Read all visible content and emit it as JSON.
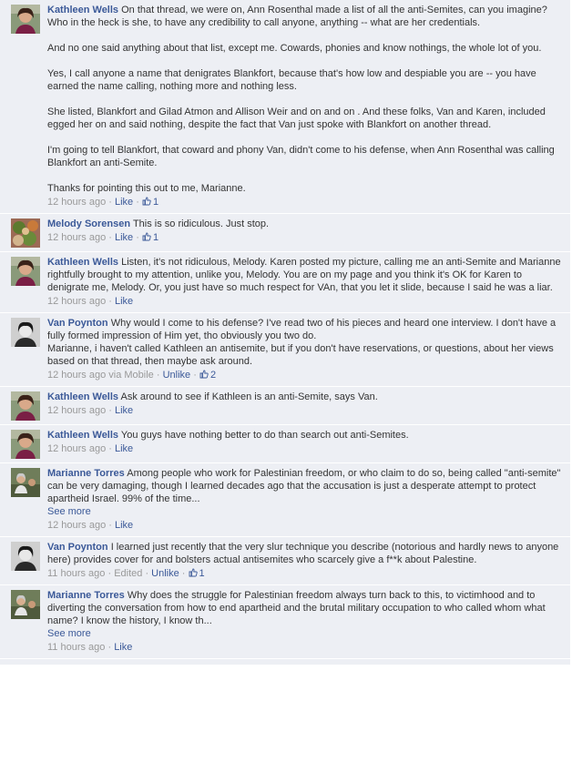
{
  "comments": [
    {
      "author": "Kathleen Wells",
      "text": "On that thread, we were on, Ann Rosenthal made a list of all the anti-Semites, can you imagine? Who in the heck is she, to have any credibility to call anyone, anything -- what are her credentials.\n\nAnd no one said anything about that list, except me. Cowards, phonies and know nothings, the whole lot of you.\n\nYes, I call anyone a name that denigrates Blankfort, because that's how low and despiable you are -- you have earned the name calling, nothing more and nothing less.\n\nShe listed, Blankfort and Gilad Atmon and Allison Weir and on and on . And these folks, Van and Karen, included egged her on and said nothing, despite the fact that Van just spoke with Blankfort on another thread.\n\nI'm going to tell Blankfort, that coward and phony Van, didn't come to his defense, when Ann Rosenthal was calling Blankfort an anti-Semite.\n\nThanks for pointing this out to me, Marianne.",
      "time": "12 hours ago",
      "via": "",
      "edited": "",
      "action": "Like",
      "likes": "1",
      "see_more": "",
      "avatar": "kathleen"
    },
    {
      "author": "Melody Sorensen",
      "text": "This is so ridiculous. Just stop.",
      "time": "12 hours ago",
      "via": "",
      "edited": "",
      "action": "Like",
      "likes": "1",
      "see_more": "",
      "avatar": "melody"
    },
    {
      "author": "Kathleen Wells",
      "text": "Listen, it's not ridiculous, Melody. Karen posted my picture, calling me an anti-Semite and Marianne rightfully brought to my attention, unlike you, Melody. You are on my page and you think it's OK for Karen to denigrate me, Melody. Or, you just have so much respect for VAn, that you let it slide, because I said he was a liar.",
      "time": "12 hours ago",
      "via": "",
      "edited": "",
      "action": "Like",
      "likes": "",
      "see_more": "",
      "avatar": "kathleen"
    },
    {
      "author": "Van Poynton",
      "text": "Why would I come to his defense? I've read two of his pieces and heard one interview. I don't have a fully formed impression of Him yet, tho obviously you two do.\nMarianne, i haven't called Kathleen an antisemite, but if you don't have reservations, or questions, about her views based on that thread, then maybe ask around.",
      "time": "12 hours ago",
      "via": "via Mobile",
      "edited": "",
      "action": "Unlike",
      "likes": "2",
      "see_more": "",
      "avatar": "van"
    },
    {
      "author": "Kathleen Wells",
      "text": "Ask around to see if Kathleen is an anti-Semite, says Van.",
      "time": "12 hours ago",
      "via": "",
      "edited": "",
      "action": "Like",
      "likes": "",
      "see_more": "",
      "avatar": "kathleen"
    },
    {
      "author": "Kathleen Wells",
      "text": "You guys have nothing better to do than search out anti-Semites.",
      "time": "12 hours ago",
      "via": "",
      "edited": "",
      "action": "Like",
      "likes": "",
      "see_more": "",
      "avatar": "kathleen"
    },
    {
      "author": "Marianne Torres",
      "text": "Among people who work for Palestinian freedom, or who claim to do so, being called \"anti-semite\" can be very damaging, though I learned decades ago that the accusation is just a desperate attempt to protect apartheid Israel. 99% of the time...",
      "time": "12 hours ago",
      "via": "",
      "edited": "",
      "action": "Like",
      "likes": "",
      "see_more": "See more",
      "avatar": "marianne"
    },
    {
      "author": "Van Poynton",
      "text": "I learned just recently that the very slur technique you describe (notorious and hardly news to anyone here) provides cover for and bolsters actual antisemites who scarcely give a f**k about Palestine.",
      "time": "11 hours ago",
      "via": "",
      "edited": "Edited",
      "action": "Unlike",
      "likes": "1",
      "see_more": "",
      "avatar": "van"
    },
    {
      "author": "Marianne Torres",
      "text": "Why does the struggle for Palestinian freedom always turn back to this, to victimhood and to diverting the conversation from how to end apartheid and the brutal military occupation to who called whom what name? I know the history, I know th...",
      "time": "11 hours ago",
      "via": "",
      "edited": "",
      "action": "Like",
      "likes": "",
      "see_more": "See more",
      "avatar": "marianne"
    }
  ],
  "colors": {
    "background": "#edeff4",
    "link": "#3b5998",
    "meta": "#999999",
    "text": "#333333"
  },
  "icons": {
    "like_count": "thumbs-up-icon"
  }
}
